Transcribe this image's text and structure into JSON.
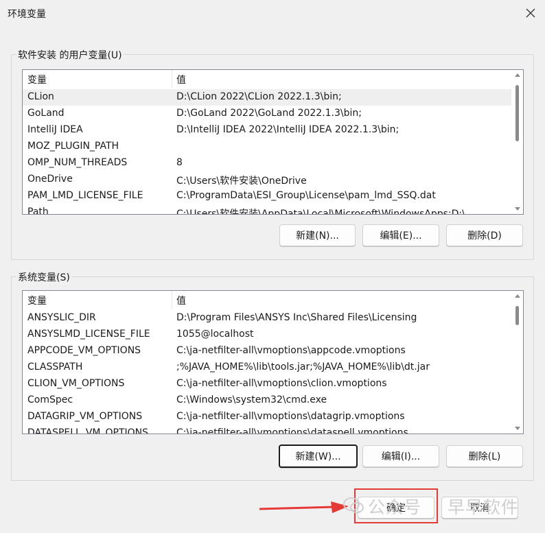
{
  "window": {
    "title": "环境变量"
  },
  "user_section": {
    "label": "软件安装 的用户变量(U)",
    "header": [
      "变量",
      "值"
    ],
    "rows": [
      [
        "CLion",
        "D:\\CLion 2022\\CLion 2022.1.3\\bin;"
      ],
      [
        "GoLand",
        "D:\\GoLand 2022\\GoLand 2022.1.3\\bin;"
      ],
      [
        "IntelliJ IDEA",
        "D:\\IntelliJ IDEA 2022\\IntelliJ IDEA 2022.1.3\\bin;"
      ],
      [
        "MOZ_PLUGIN_PATH",
        ""
      ],
      [
        "OMP_NUM_THREADS",
        "8"
      ],
      [
        "OneDrive",
        "C:\\Users\\软件安装\\OneDrive"
      ],
      [
        "PAM_LMD_LICENSE_FILE",
        "C:\\ProgramData\\ESI_Group\\License\\pam_lmd_SSQ.dat"
      ],
      [
        "Path",
        "C:\\Users\\软件安装\\AppData\\Local\\Microsoft\\WindowsApps;D:\\..."
      ]
    ],
    "selected_row": 0,
    "buttons": {
      "new": "新建(N)...",
      "edit": "编辑(E)...",
      "delete": "删除(D)"
    }
  },
  "system_section": {
    "label": "系统变量(S)",
    "header": [
      "变量",
      "值"
    ],
    "rows": [
      [
        "ANSYSLIC_DIR",
        "D:\\Program Files\\ANSYS Inc\\Shared Files\\Licensing"
      ],
      [
        "ANSYSLMD_LICENSE_FILE",
        "1055@localhost"
      ],
      [
        "APPCODE_VM_OPTIONS",
        "C:\\ja-netfilter-all\\vmoptions\\appcode.vmoptions"
      ],
      [
        "CLASSPATH",
        ";%JAVA_HOME%\\lib\\tools.jar;%JAVA_HOME%\\lib\\dt.jar"
      ],
      [
        "CLION_VM_OPTIONS",
        "C:\\ja-netfilter-all\\vmoptions\\clion.vmoptions"
      ],
      [
        "ComSpec",
        "C:\\Windows\\system32\\cmd.exe"
      ],
      [
        "DATAGRIP_VM_OPTIONS",
        "C:\\ja-netfilter-all\\vmoptions\\datagrip.vmoptions"
      ],
      [
        "DATASPELL_VM_OPTIONS",
        "C:\\ja-netfilter-all\\vmoptions\\dataspell.vmoptions"
      ]
    ],
    "buttons": {
      "new": "新建(W)...",
      "edit": "编辑(I)...",
      "delete": "删除(L)"
    }
  },
  "footer": {
    "ok": "确定",
    "cancel": "取消"
  },
  "watermark": {
    "left": "公众号",
    "right": "早早软件"
  },
  "colors": {
    "highlight": "#e53935",
    "selected_row": "#efefef"
  }
}
